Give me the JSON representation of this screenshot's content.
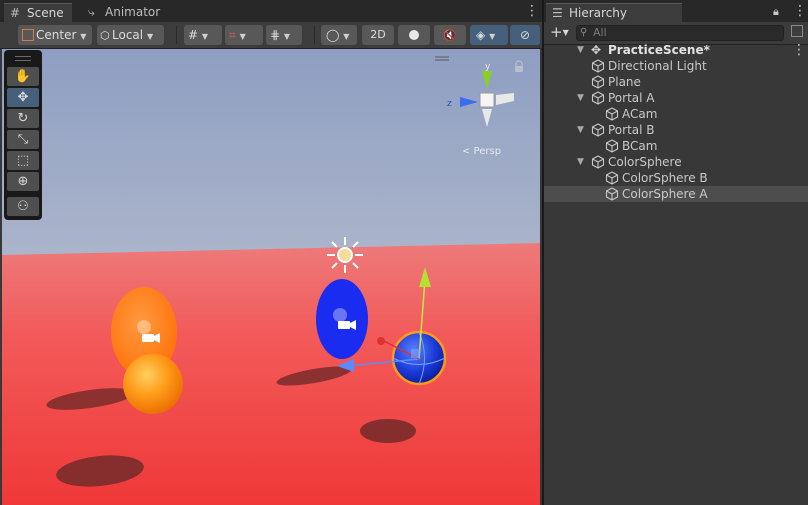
{
  "scene_tabs": [
    {
      "label": "Scene",
      "icon": "grid-icon",
      "active": true
    },
    {
      "label": "Animator",
      "icon": "animator-icon",
      "active": false
    }
  ],
  "toolbar": {
    "pivot_label": "Center",
    "space_label": "Local",
    "two_d_label": "2D"
  },
  "gizmo": {
    "axis_y": "y",
    "axis_z": "z",
    "view_label": "< Persp"
  },
  "hierarchy": {
    "tab_label": "Hierarchy",
    "search_placeholder": "All",
    "scene_name": "PracticeScene*",
    "items": [
      {
        "label": "Directional Light",
        "depth": 1,
        "expandable": false,
        "selected": false
      },
      {
        "label": "Plane",
        "depth": 1,
        "expandable": false,
        "selected": false
      },
      {
        "label": "Portal A",
        "depth": 1,
        "expandable": true,
        "selected": false
      },
      {
        "label": "ACam",
        "depth": 2,
        "expandable": false,
        "selected": false
      },
      {
        "label": "Portal B",
        "depth": 1,
        "expandable": true,
        "selected": false
      },
      {
        "label": "BCam",
        "depth": 2,
        "expandable": false,
        "selected": false
      },
      {
        "label": "ColorSphere",
        "depth": 1,
        "expandable": true,
        "selected": false
      },
      {
        "label": "ColorSphere B",
        "depth": 2,
        "expandable": false,
        "selected": false
      },
      {
        "label": "ColorSphere A",
        "depth": 2,
        "expandable": false,
        "selected": true
      }
    ]
  },
  "colors": {
    "sky": "#9aa8c8",
    "ground": "#f05555",
    "portal_a": "#ff8010",
    "portal_b": "#1a2cf0",
    "selection": "#4d4d4d"
  }
}
